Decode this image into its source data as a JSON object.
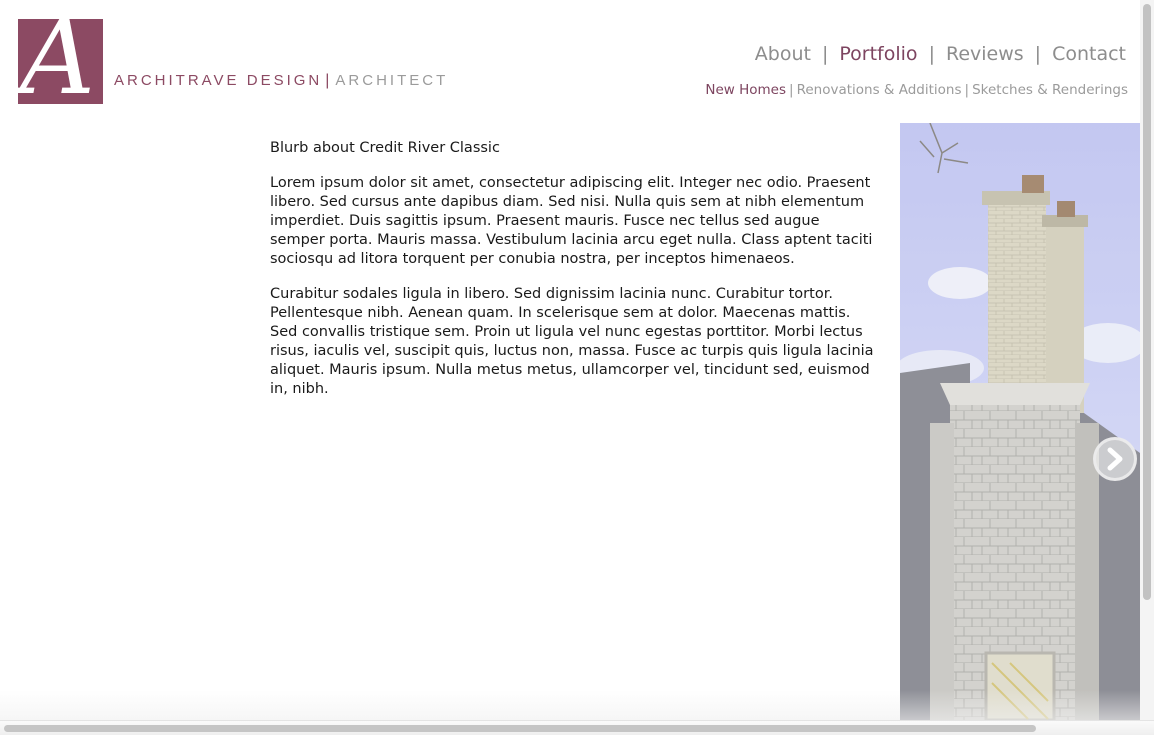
{
  "brand": {
    "logo_letter": "A",
    "name": "ARCHITRAVE DESIGN",
    "separator": "|",
    "role": "ARCHITECT",
    "accent_color": "#8c4a63"
  },
  "nav": {
    "items": [
      {
        "label": "About",
        "active": false
      },
      {
        "label": "Portfolio",
        "active": true
      },
      {
        "label": "Reviews",
        "active": false
      },
      {
        "label": "Contact",
        "active": false
      }
    ],
    "separator": "|"
  },
  "subnav": {
    "items": [
      {
        "label": "New Homes",
        "active": true
      },
      {
        "label": "Renovations & Additions",
        "active": false
      },
      {
        "label": "Sketches & Renderings",
        "active": false
      }
    ],
    "separator": "|"
  },
  "content": {
    "title": "Blurb about Credit River Classic",
    "paragraphs": [
      "Lorem ipsum dolor sit amet, consectetur adipiscing elit. Integer nec odio. Praesent libero. Sed cursus ante dapibus diam. Sed nisi. Nulla quis sem at nibh elementum imperdiet. Duis sagittis ipsum. Praesent mauris. Fusce nec tellus sed augue semper porta. Mauris massa. Vestibulum lacinia arcu eget nulla. Class aptent taciti sociosqu ad litora torquent per conubia nostra, per inceptos himenaeos.",
      "Curabitur sodales ligula in libero. Sed dignissim lacinia nunc. Curabitur tortor. Pellentesque nibh. Aenean quam. In scelerisque sem at dolor. Maecenas mattis. Sed convallis tristique sem. Proin ut ligula vel nunc egestas porttitor. Morbi lectus risus, iaculis vel, suscipit quis, luctus non, massa. Fusce ac turpis quis ligula lacinia aliquet. Mauris ipsum. Nulla metus metus, ullamcorper vel, tincidunt sed, euismod in, nibh."
    ]
  },
  "gallery": {
    "next_icon": "chevron-right-icon"
  }
}
